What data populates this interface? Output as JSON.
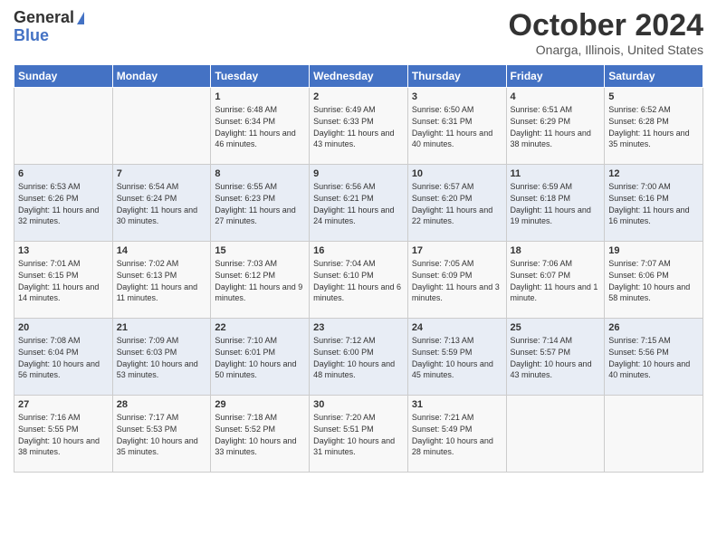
{
  "header": {
    "logo_general": "General",
    "logo_blue": "Blue",
    "title": "October 2024",
    "location": "Onarga, Illinois, United States"
  },
  "days_of_week": [
    "Sunday",
    "Monday",
    "Tuesday",
    "Wednesday",
    "Thursday",
    "Friday",
    "Saturday"
  ],
  "weeks": [
    [
      {
        "day": "",
        "info": ""
      },
      {
        "day": "",
        "info": ""
      },
      {
        "day": "1",
        "sunrise": "6:48 AM",
        "sunset": "6:34 PM",
        "daylight": "11 hours and 46 minutes."
      },
      {
        "day": "2",
        "sunrise": "6:49 AM",
        "sunset": "6:33 PM",
        "daylight": "11 hours and 43 minutes."
      },
      {
        "day": "3",
        "sunrise": "6:50 AM",
        "sunset": "6:31 PM",
        "daylight": "11 hours and 40 minutes."
      },
      {
        "day": "4",
        "sunrise": "6:51 AM",
        "sunset": "6:29 PM",
        "daylight": "11 hours and 38 minutes."
      },
      {
        "day": "5",
        "sunrise": "6:52 AM",
        "sunset": "6:28 PM",
        "daylight": "11 hours and 35 minutes."
      }
    ],
    [
      {
        "day": "6",
        "sunrise": "6:53 AM",
        "sunset": "6:26 PM",
        "daylight": "11 hours and 32 minutes."
      },
      {
        "day": "7",
        "sunrise": "6:54 AM",
        "sunset": "6:24 PM",
        "daylight": "11 hours and 30 minutes."
      },
      {
        "day": "8",
        "sunrise": "6:55 AM",
        "sunset": "6:23 PM",
        "daylight": "11 hours and 27 minutes."
      },
      {
        "day": "9",
        "sunrise": "6:56 AM",
        "sunset": "6:21 PM",
        "daylight": "11 hours and 24 minutes."
      },
      {
        "day": "10",
        "sunrise": "6:57 AM",
        "sunset": "6:20 PM",
        "daylight": "11 hours and 22 minutes."
      },
      {
        "day": "11",
        "sunrise": "6:59 AM",
        "sunset": "6:18 PM",
        "daylight": "11 hours and 19 minutes."
      },
      {
        "day": "12",
        "sunrise": "7:00 AM",
        "sunset": "6:16 PM",
        "daylight": "11 hours and 16 minutes."
      }
    ],
    [
      {
        "day": "13",
        "sunrise": "7:01 AM",
        "sunset": "6:15 PM",
        "daylight": "11 hours and 14 minutes."
      },
      {
        "day": "14",
        "sunrise": "7:02 AM",
        "sunset": "6:13 PM",
        "daylight": "11 hours and 11 minutes."
      },
      {
        "day": "15",
        "sunrise": "7:03 AM",
        "sunset": "6:12 PM",
        "daylight": "11 hours and 9 minutes."
      },
      {
        "day": "16",
        "sunrise": "7:04 AM",
        "sunset": "6:10 PM",
        "daylight": "11 hours and 6 minutes."
      },
      {
        "day": "17",
        "sunrise": "7:05 AM",
        "sunset": "6:09 PM",
        "daylight": "11 hours and 3 minutes."
      },
      {
        "day": "18",
        "sunrise": "7:06 AM",
        "sunset": "6:07 PM",
        "daylight": "11 hours and 1 minute."
      },
      {
        "day": "19",
        "sunrise": "7:07 AM",
        "sunset": "6:06 PM",
        "daylight": "10 hours and 58 minutes."
      }
    ],
    [
      {
        "day": "20",
        "sunrise": "7:08 AM",
        "sunset": "6:04 PM",
        "daylight": "10 hours and 56 minutes."
      },
      {
        "day": "21",
        "sunrise": "7:09 AM",
        "sunset": "6:03 PM",
        "daylight": "10 hours and 53 minutes."
      },
      {
        "day": "22",
        "sunrise": "7:10 AM",
        "sunset": "6:01 PM",
        "daylight": "10 hours and 50 minutes."
      },
      {
        "day": "23",
        "sunrise": "7:12 AM",
        "sunset": "6:00 PM",
        "daylight": "10 hours and 48 minutes."
      },
      {
        "day": "24",
        "sunrise": "7:13 AM",
        "sunset": "5:59 PM",
        "daylight": "10 hours and 45 minutes."
      },
      {
        "day": "25",
        "sunrise": "7:14 AM",
        "sunset": "5:57 PM",
        "daylight": "10 hours and 43 minutes."
      },
      {
        "day": "26",
        "sunrise": "7:15 AM",
        "sunset": "5:56 PM",
        "daylight": "10 hours and 40 minutes."
      }
    ],
    [
      {
        "day": "27",
        "sunrise": "7:16 AM",
        "sunset": "5:55 PM",
        "daylight": "10 hours and 38 minutes."
      },
      {
        "day": "28",
        "sunrise": "7:17 AM",
        "sunset": "5:53 PM",
        "daylight": "10 hours and 35 minutes."
      },
      {
        "day": "29",
        "sunrise": "7:18 AM",
        "sunset": "5:52 PM",
        "daylight": "10 hours and 33 minutes."
      },
      {
        "day": "30",
        "sunrise": "7:20 AM",
        "sunset": "5:51 PM",
        "daylight": "10 hours and 31 minutes."
      },
      {
        "day": "31",
        "sunrise": "7:21 AM",
        "sunset": "5:49 PM",
        "daylight": "10 hours and 28 minutes."
      },
      {
        "day": "",
        "info": ""
      },
      {
        "day": "",
        "info": ""
      }
    ]
  ]
}
